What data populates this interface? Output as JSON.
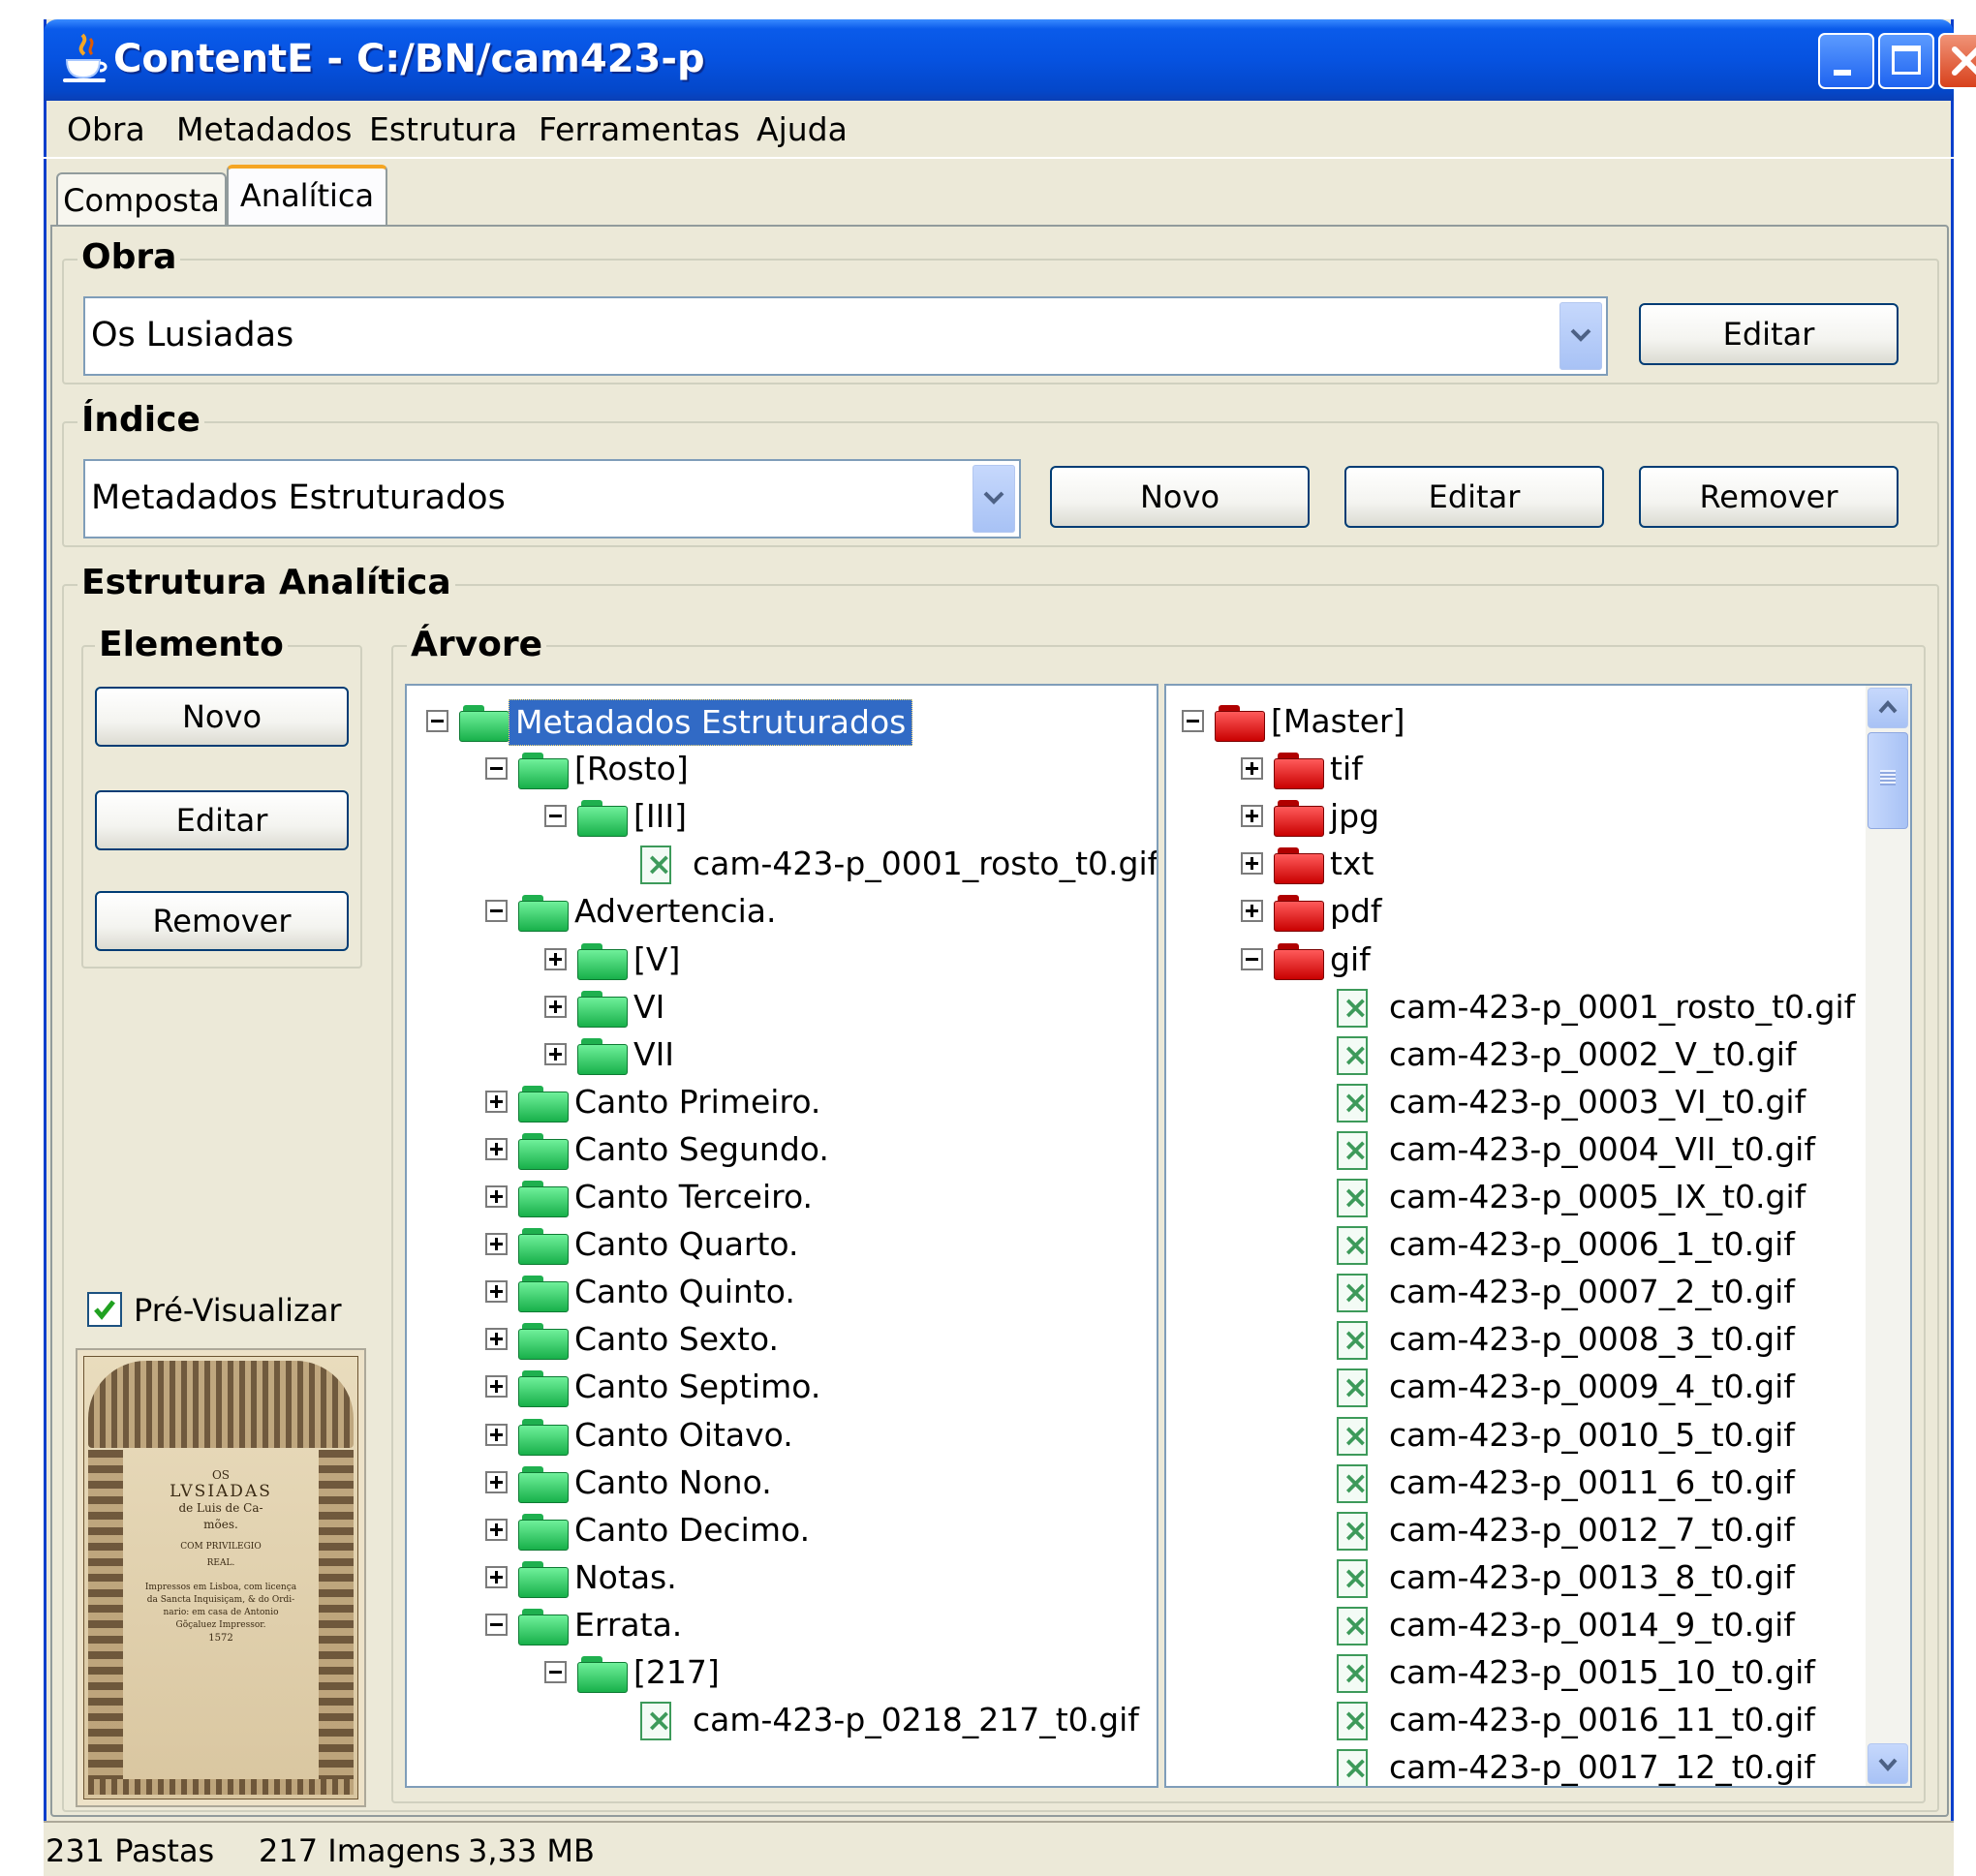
{
  "window": {
    "title": "ContentE - C:/BN/cam423-p"
  },
  "menu": [
    "Obra",
    "Metadados",
    "Estrutura",
    "Ferramentas",
    "Ajuda"
  ],
  "tabs": {
    "composta": "Composta",
    "analitica": "Analítica",
    "active": "Analítica"
  },
  "obra": {
    "title": "Obra",
    "selected": "Os Lusiadas",
    "edit": "Editar"
  },
  "indice": {
    "title": "Índice",
    "selected": "Metadados Estruturados",
    "new": "Novo",
    "edit": "Editar",
    "remove": "Remover"
  },
  "estrutura": {
    "title": "Estrutura Analítica"
  },
  "elemento": {
    "title": "Elemento",
    "new": "Novo",
    "edit": "Editar",
    "remove": "Remover",
    "preview_label": "Pré-Visualizar",
    "preview_checked": true
  },
  "preview_image": {
    "lines": [
      "OS",
      "LVSIADAS",
      "de Luis de Ca-",
      "mões.",
      "COM PRIVILEGIO",
      "REAL.",
      "Impressos em Lisboa, com licença",
      "da Sancta Inquisiçam, & do Ordi-",
      "nario: em casa de Antonio",
      "Gõçaluez Impressor.",
      "1572"
    ]
  },
  "arvore": {
    "title": "Árvore"
  },
  "left_tree": [
    {
      "level": 0,
      "state": "minus",
      "icon": "folder-green",
      "label": "Metadados Estruturados",
      "selected": true
    },
    {
      "level": 1,
      "state": "minus",
      "icon": "folder-green",
      "label": "[Rosto]"
    },
    {
      "level": 2,
      "state": "minus",
      "icon": "folder-green",
      "label": "[III]"
    },
    {
      "level": 3,
      "state": "none",
      "icon": "file",
      "label": "cam-423-p_0001_rosto_t0.gif"
    },
    {
      "level": 1,
      "state": "minus",
      "icon": "folder-green",
      "label": "Advertencia."
    },
    {
      "level": 2,
      "state": "plus",
      "icon": "folder-green",
      "label": "[V]"
    },
    {
      "level": 2,
      "state": "plus",
      "icon": "folder-green",
      "label": "VI"
    },
    {
      "level": 2,
      "state": "plus",
      "icon": "folder-green",
      "label": "VII"
    },
    {
      "level": 1,
      "state": "plus",
      "icon": "folder-green",
      "label": "Canto Primeiro."
    },
    {
      "level": 1,
      "state": "plus",
      "icon": "folder-green",
      "label": "Canto Segundo."
    },
    {
      "level": 1,
      "state": "plus",
      "icon": "folder-green",
      "label": "Canto Terceiro."
    },
    {
      "level": 1,
      "state": "plus",
      "icon": "folder-green",
      "label": "Canto Quarto."
    },
    {
      "level": 1,
      "state": "plus",
      "icon": "folder-green",
      "label": "Canto Quinto."
    },
    {
      "level": 1,
      "state": "plus",
      "icon": "folder-green",
      "label": "Canto Sexto."
    },
    {
      "level": 1,
      "state": "plus",
      "icon": "folder-green",
      "label": "Canto Septimo."
    },
    {
      "level": 1,
      "state": "plus",
      "icon": "folder-green",
      "label": "Canto Oitavo."
    },
    {
      "level": 1,
      "state": "plus",
      "icon": "folder-green",
      "label": "Canto Nono."
    },
    {
      "level": 1,
      "state": "plus",
      "icon": "folder-green",
      "label": "Canto Decimo."
    },
    {
      "level": 1,
      "state": "plus",
      "icon": "folder-green",
      "label": "Notas."
    },
    {
      "level": 1,
      "state": "minus",
      "icon": "folder-green",
      "label": "Errata."
    },
    {
      "level": 2,
      "state": "minus",
      "icon": "folder-green",
      "label": "[217]"
    },
    {
      "level": 3,
      "state": "none",
      "icon": "file",
      "label": "cam-423-p_0218_217_t0.gif"
    }
  ],
  "right_tree": [
    {
      "level": 0,
      "state": "minus",
      "icon": "folder-red",
      "label": "[Master]"
    },
    {
      "level": 1,
      "state": "plus",
      "icon": "folder-red",
      "label": "tif"
    },
    {
      "level": 1,
      "state": "plus",
      "icon": "folder-red",
      "label": "jpg"
    },
    {
      "level": 1,
      "state": "plus",
      "icon": "folder-red",
      "label": "txt"
    },
    {
      "level": 1,
      "state": "plus",
      "icon": "folder-red",
      "label": "pdf"
    },
    {
      "level": 1,
      "state": "minus",
      "icon": "folder-red",
      "label": "gif"
    },
    {
      "level": 2,
      "state": "none",
      "icon": "file",
      "label": "cam-423-p_0001_rosto_t0.gif"
    },
    {
      "level": 2,
      "state": "none",
      "icon": "file",
      "label": "cam-423-p_0002_V_t0.gif"
    },
    {
      "level": 2,
      "state": "none",
      "icon": "file",
      "label": "cam-423-p_0003_VI_t0.gif"
    },
    {
      "level": 2,
      "state": "none",
      "icon": "file",
      "label": "cam-423-p_0004_VII_t0.gif"
    },
    {
      "level": 2,
      "state": "none",
      "icon": "file",
      "label": "cam-423-p_0005_IX_t0.gif"
    },
    {
      "level": 2,
      "state": "none",
      "icon": "file",
      "label": "cam-423-p_0006_1_t0.gif"
    },
    {
      "level": 2,
      "state": "none",
      "icon": "file",
      "label": "cam-423-p_0007_2_t0.gif"
    },
    {
      "level": 2,
      "state": "none",
      "icon": "file",
      "label": "cam-423-p_0008_3_t0.gif"
    },
    {
      "level": 2,
      "state": "none",
      "icon": "file",
      "label": "cam-423-p_0009_4_t0.gif"
    },
    {
      "level": 2,
      "state": "none",
      "icon": "file",
      "label": "cam-423-p_0010_5_t0.gif"
    },
    {
      "level": 2,
      "state": "none",
      "icon": "file",
      "label": "cam-423-p_0011_6_t0.gif"
    },
    {
      "level": 2,
      "state": "none",
      "icon": "file",
      "label": "cam-423-p_0012_7_t0.gif"
    },
    {
      "level": 2,
      "state": "none",
      "icon": "file",
      "label": "cam-423-p_0013_8_t0.gif"
    },
    {
      "level": 2,
      "state": "none",
      "icon": "file",
      "label": "cam-423-p_0014_9_t0.gif"
    },
    {
      "level": 2,
      "state": "none",
      "icon": "file",
      "label": "cam-423-p_0015_10_t0.gif"
    },
    {
      "level": 2,
      "state": "none",
      "icon": "file",
      "label": "cam-423-p_0016_11_t0.gif"
    },
    {
      "level": 2,
      "state": "none",
      "icon": "file",
      "label": "cam-423-p_0017_12_t0.gif"
    }
  ],
  "status": {
    "folders": "231 Pastas",
    "images": "217 Imagens",
    "size": "3,33 MB"
  },
  "colors": {
    "titlebar": "#0652E0",
    "window_bg": "#ECE9D8",
    "selection": "#316AC5",
    "folder_green": "#18B04A",
    "folder_red": "#C90000",
    "tab_highlight": "#F5A623"
  }
}
